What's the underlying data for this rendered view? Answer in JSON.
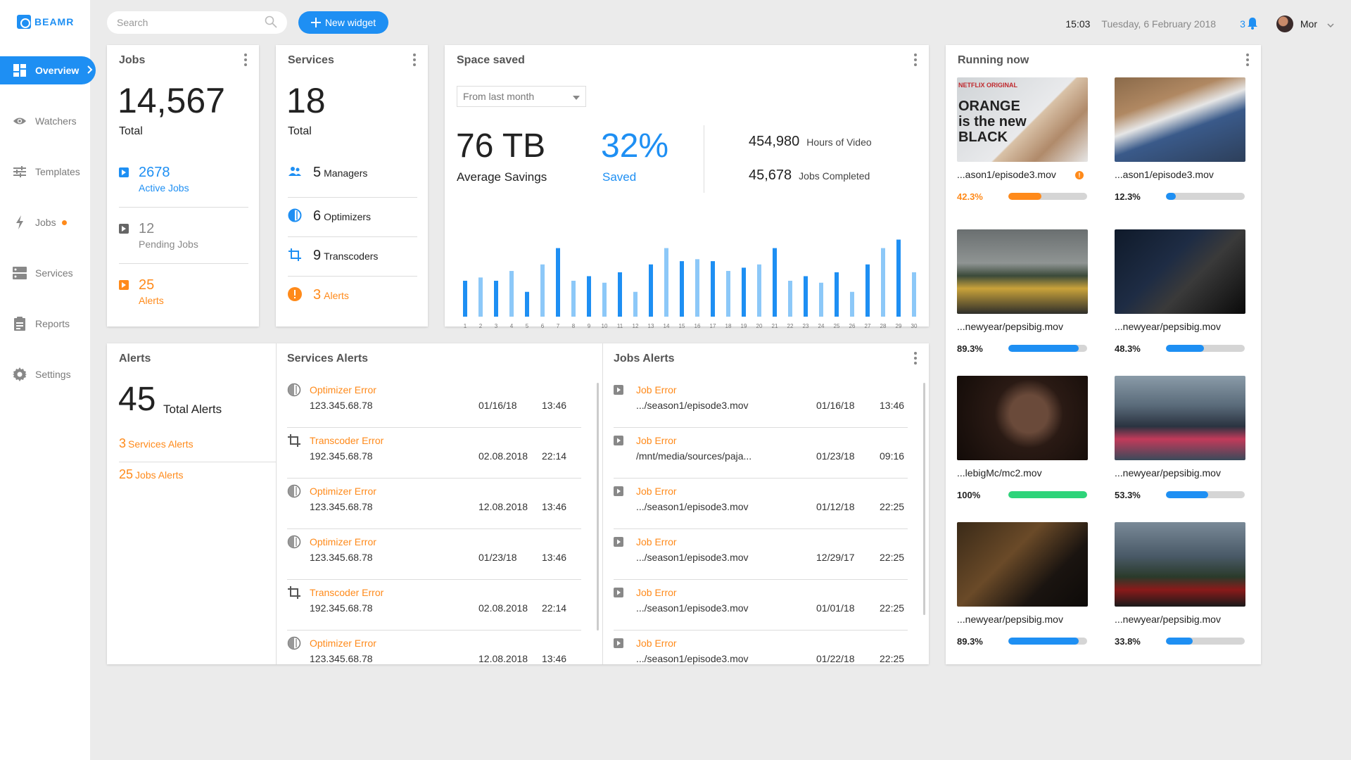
{
  "brand": {
    "name": "BEAMR",
    "accent": "#1e8ff3",
    "warning": "#ff8a1a",
    "success": "#2ed47a"
  },
  "sidebar": {
    "items": [
      {
        "label": "Overview",
        "icon": "dashboard-icon",
        "active": true
      },
      {
        "label": "Watchers",
        "icon": "eye-icon"
      },
      {
        "label": "Templates",
        "icon": "sliders-icon"
      },
      {
        "label": "Jobs",
        "icon": "bolt-icon",
        "badge_dot": true
      },
      {
        "label": "Services",
        "icon": "server-icon"
      },
      {
        "label": "Reports",
        "icon": "clipboard-icon"
      },
      {
        "label": "Settings",
        "icon": "gear-icon"
      }
    ]
  },
  "topbar": {
    "search_placeholder": "Search",
    "new_widget_label": "New widget",
    "time": "15:03",
    "date": "Tuesday, 6 February 2018",
    "notifications": "3",
    "user": "Mor"
  },
  "jobs": {
    "title": "Jobs",
    "total": "14,567",
    "total_label": "Total",
    "active_count": "2678",
    "active_label": "Active Jobs",
    "pending_count": "12",
    "pending_label": "Pending Jobs",
    "alerts_count": "25",
    "alerts_label": "Alerts"
  },
  "services": {
    "title": "Services",
    "total": "18",
    "total_label": "Total",
    "managers_count": "5",
    "managers_label": "Managers",
    "optimizers_count": "6",
    "optimizers_label": "Optimizers",
    "transcoders_count": "9",
    "transcoders_label": "Transcoders",
    "alerts_count": "3",
    "alerts_label": "Alerts"
  },
  "space_saved": {
    "title": "Space saved",
    "range_select": "From last month",
    "avg_value": "76 TB",
    "avg_label": "Average Savings",
    "saved_pct": "32%",
    "saved_label": "Saved",
    "hours_value": "454,980",
    "hours_label": "Hours of Video",
    "jobs_value": "45,678",
    "jobs_label": "Jobs Completed"
  },
  "chart_data": {
    "type": "bar",
    "categories": [
      "1",
      "2",
      "3",
      "4",
      "5",
      "6",
      "7",
      "8",
      "9",
      "10",
      "11",
      "12",
      "13",
      "14",
      "15",
      "16",
      "17",
      "18",
      "19",
      "20",
      "21",
      "22",
      "23",
      "24",
      "25",
      "26",
      "27",
      "28",
      "29",
      "30"
    ],
    "values": [
      55,
      60,
      55,
      70,
      38,
      80,
      105,
      55,
      62,
      52,
      68,
      38,
      80,
      105,
      85,
      88,
      85,
      70,
      75,
      80,
      105,
      55,
      62,
      52,
      68,
      38,
      80,
      105,
      118,
      68
    ],
    "colors": [
      "dark",
      "light",
      "dark",
      "light",
      "dark",
      "light",
      "dark",
      "light",
      "dark",
      "light",
      "dark",
      "light",
      "dark",
      "light",
      "dark",
      "light",
      "dark",
      "light",
      "dark",
      "light",
      "dark",
      "light",
      "dark",
      "light",
      "dark",
      "light",
      "dark",
      "light",
      "dark",
      "light"
    ],
    "bar_colors": {
      "dark": "#1e8ff3",
      "light": "#8cc8f8"
    },
    "ylim": [
      0,
      125
    ],
    "grid": false
  },
  "alerts": {
    "title": "Alerts",
    "total": "45",
    "total_label": "Total Alerts",
    "services_count": "3",
    "services_label": "Services Alerts",
    "jobs_count": "25",
    "jobs_label": "Jobs Alerts"
  },
  "services_alerts": {
    "title": "Services Alerts",
    "items": [
      {
        "icon": "optimizer-icon",
        "type": "Optimizer Error",
        "addr": "123.345.68.78",
        "date": "01/16/18",
        "time": "13:46"
      },
      {
        "icon": "crop-icon",
        "type": "Transcoder Error",
        "addr": "192.345.68.78",
        "date": "02.08.2018",
        "time": "22:14"
      },
      {
        "icon": "optimizer-icon",
        "type": "Optimizer Error",
        "addr": "123.345.68.78",
        "date": "12.08.2018",
        "time": "13:46"
      },
      {
        "icon": "optimizer-icon",
        "type": "Optimizer Error",
        "addr": "123.345.68.78",
        "date": "01/23/18",
        "time": "13:46"
      },
      {
        "icon": "crop-icon",
        "type": "Transcoder Error",
        "addr": "192.345.68.78",
        "date": "02.08.2018",
        "time": "22:14"
      },
      {
        "icon": "optimizer-icon",
        "type": "Optimizer Error",
        "addr": "123.345.68.78",
        "date": "12.08.2018",
        "time": "13:46"
      }
    ]
  },
  "jobs_alerts": {
    "title": "Jobs Alerts",
    "items": [
      {
        "type": "Job Error",
        "path": ".../season1/episode3.mov",
        "date": "01/16/18",
        "time": "13:46"
      },
      {
        "type": "Job Error",
        "path": "/mnt/media/sources/paja...",
        "date": "01/23/18",
        "time": "09:16"
      },
      {
        "type": "Job Error",
        "path": ".../season1/episode3.mov",
        "date": "01/12/18",
        "time": "22:25"
      },
      {
        "type": "Job Error",
        "path": ".../season1/episode3.mov",
        "date": "12/29/17",
        "time": "22:25"
      },
      {
        "type": "Job Error",
        "path": ".../season1/episode3.mov",
        "date": "01/01/18",
        "time": "22:25"
      },
      {
        "type": "Job Error",
        "path": ".../season1/episode3.mov",
        "date": "01/22/18",
        "time": "22:25"
      }
    ]
  },
  "running_now": {
    "title": "Running now",
    "items": [
      {
        "name": "...ason1/episode3.mov",
        "pct": "42.3%",
        "value": 0.423,
        "color": "#ff8a1a",
        "warning": true,
        "poster_text": "ORANGE is the new BLACK",
        "poster_brand": "NETFLIX ORIGINAL"
      },
      {
        "name": "...ason1/episode3.mov",
        "pct": "12.3%",
        "value": 0.123,
        "color": "#1e8ff3"
      },
      {
        "name": "...newyear/pepsibig.mov",
        "pct": "89.3%",
        "value": 0.893,
        "color": "#1e8ff3"
      },
      {
        "name": "...newyear/pepsibig.mov",
        "pct": "48.3%",
        "value": 0.483,
        "color": "#1e8ff3"
      },
      {
        "name": "...lebigMc/mc2.mov",
        "pct": "100%",
        "value": 1.0,
        "color": "#2ed47a"
      },
      {
        "name": "...newyear/pepsibig.mov",
        "pct": "53.3%",
        "value": 0.533,
        "color": "#1e8ff3"
      },
      {
        "name": "...newyear/pepsibig.mov",
        "pct": "89.3%",
        "value": 0.893,
        "color": "#1e8ff3"
      },
      {
        "name": "...newyear/pepsibig.mov",
        "pct": "33.8%",
        "value": 0.338,
        "color": "#1e8ff3"
      }
    ]
  }
}
